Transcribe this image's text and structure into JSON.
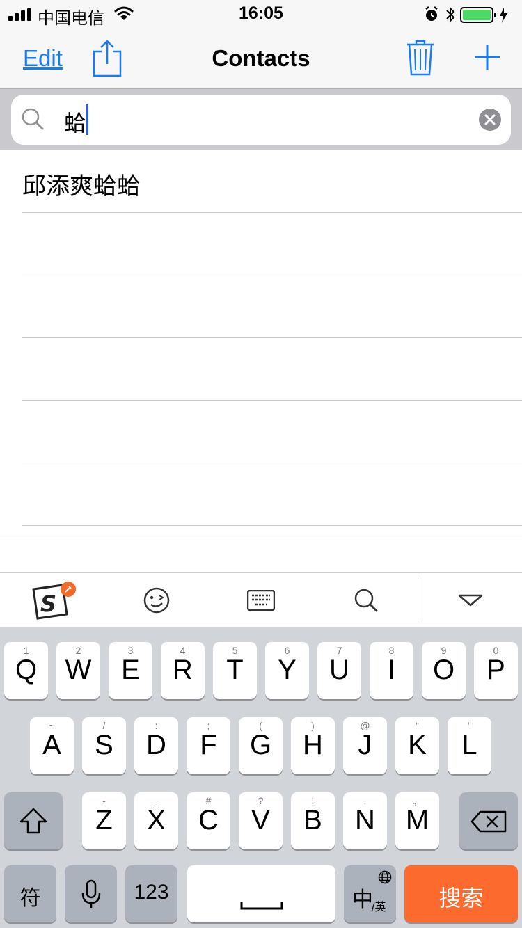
{
  "status_bar": {
    "carrier": "中国电信",
    "time": "16:05"
  },
  "nav": {
    "edit_label": "Edit",
    "title": "Contacts"
  },
  "search": {
    "query": "蛤"
  },
  "results": [
    {
      "name": "邱添爽蛤蛤"
    },
    {
      "name": ""
    },
    {
      "name": ""
    },
    {
      "name": ""
    },
    {
      "name": ""
    },
    {
      "name": ""
    }
  ],
  "ime_toolbar": {
    "items": [
      "sogou-logo-icon",
      "emoji-icon",
      "keyboard-icon",
      "search-icon",
      "collapse-chevron-icon"
    ]
  },
  "keyboard": {
    "row1": [
      {
        "k": "Q",
        "s": "1"
      },
      {
        "k": "W",
        "s": "2"
      },
      {
        "k": "E",
        "s": "3"
      },
      {
        "k": "R",
        "s": "4"
      },
      {
        "k": "T",
        "s": "5"
      },
      {
        "k": "Y",
        "s": "6"
      },
      {
        "k": "U",
        "s": "7"
      },
      {
        "k": "I",
        "s": "8"
      },
      {
        "k": "O",
        "s": "9"
      },
      {
        "k": "P",
        "s": "0"
      }
    ],
    "row2": [
      {
        "k": "A",
        "s": "~"
      },
      {
        "k": "S",
        "s": "/"
      },
      {
        "k": "D",
        "s": ":"
      },
      {
        "k": "F",
        "s": ";"
      },
      {
        "k": "G",
        "s": "("
      },
      {
        "k": "H",
        "s": ")"
      },
      {
        "k": "J",
        "s": "@"
      },
      {
        "k": "K",
        "s": "“"
      },
      {
        "k": "L",
        "s": "”"
      }
    ],
    "row3": [
      {
        "k": "Z",
        "s": "-"
      },
      {
        "k": "X",
        "s": "_"
      },
      {
        "k": "C",
        "s": "#"
      },
      {
        "k": "V",
        "s": "?"
      },
      {
        "k": "B",
        "s": "!"
      },
      {
        "k": "N",
        "s": ","
      },
      {
        "k": "M",
        "s": "。"
      }
    ],
    "symbol_label": "符",
    "numbers_label": "123",
    "lang_main": "中",
    "lang_sub": "/英",
    "search_label": "搜索",
    "accent_color": "#fd6a2d"
  }
}
